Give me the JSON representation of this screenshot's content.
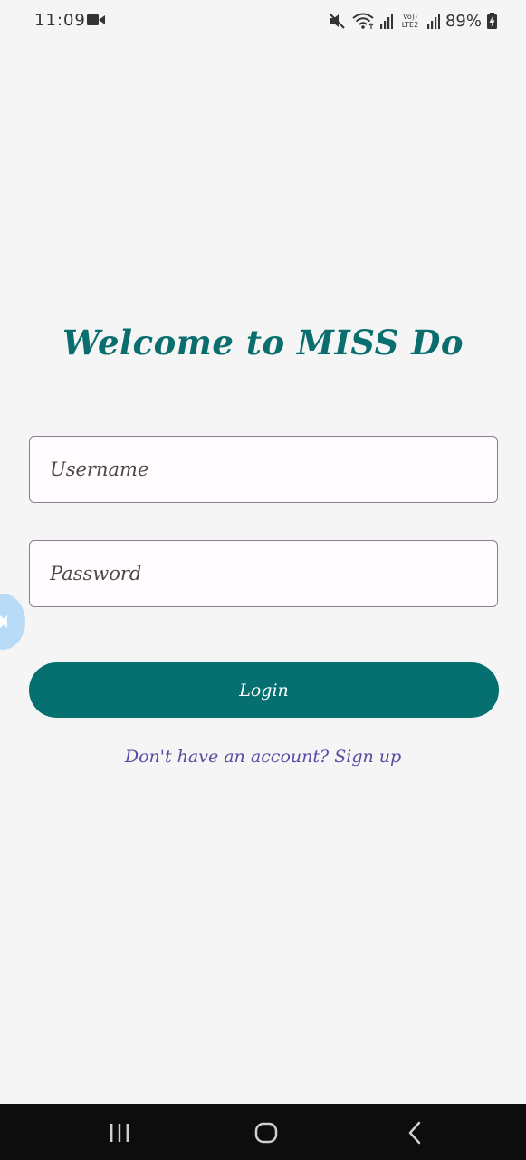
{
  "status_bar": {
    "time": "11:09",
    "battery": "89%",
    "network_label": "Vo)) LTE2"
  },
  "login": {
    "title": "Welcome to MISS Do",
    "username_placeholder": "Username",
    "password_placeholder": "Password",
    "login_label": "Login",
    "signup_text": "Don't have an account? Sign up"
  },
  "colors": {
    "accent": "#066f70",
    "title": "#0b6e6e",
    "link": "#5b4aa2",
    "background": "#f5f5f5",
    "nav_bar": "#0d0d0d"
  },
  "icons": {
    "status": [
      "video-record-icon",
      "mute-icon",
      "wifi-icon",
      "signal-icon",
      "battery-charging-icon"
    ],
    "nav": [
      "recents-icon",
      "home-icon",
      "back-icon"
    ],
    "floating": "floating-bubble-icon"
  }
}
